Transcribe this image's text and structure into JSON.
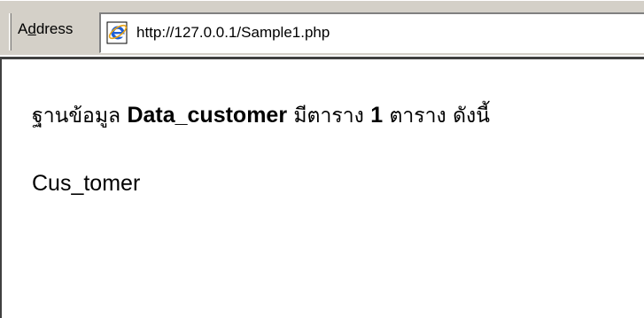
{
  "address_bar": {
    "label_prefix": "A",
    "label_mnemonic": "d",
    "label_suffix": "dress",
    "url": "http://127.0.0.1/Sample1.php",
    "icon": "ie-page-icon"
  },
  "page": {
    "heading_prefix": "ฐานข้อมูล",
    "database_name": "Data_customer",
    "heading_middle": "มีตาราง",
    "table_count": "1",
    "heading_suffix": "ตาราง ดังนี้",
    "tables": [
      "Cus_tomer"
    ]
  }
}
